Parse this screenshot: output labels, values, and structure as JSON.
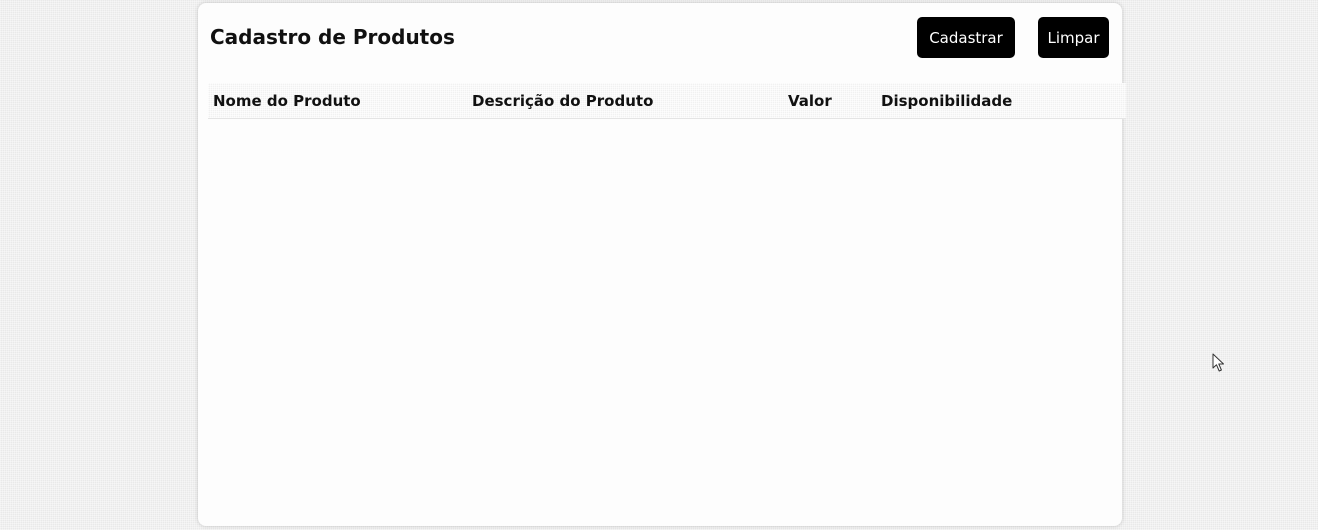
{
  "header": {
    "title": "Cadastro de Produtos",
    "cadastrar_label": "Cadastrar",
    "limpar_label": "Limpar"
  },
  "table": {
    "columns": [
      "Nome do Produto",
      "Descrição do Produto",
      "Valor",
      "Disponibilidade"
    ],
    "rows": []
  },
  "icons": {
    "cursor": "mouse-pointer-icon"
  },
  "colors": {
    "button_bg": "#000000",
    "button_text": "#ffffff",
    "card_bg": "#fdfdfd"
  }
}
